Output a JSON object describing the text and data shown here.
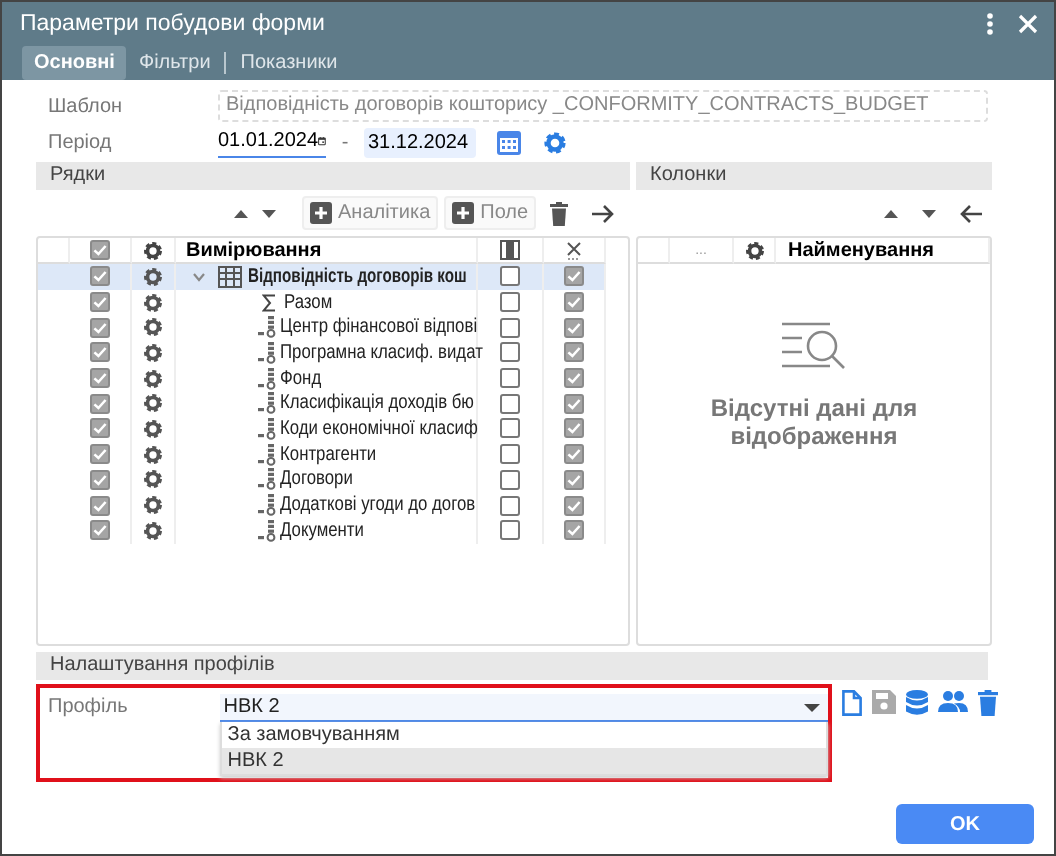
{
  "window": {
    "title": "Параметри побудови форми"
  },
  "tabs": [
    {
      "label": "Основні",
      "selected": true
    },
    {
      "label": "Фільтри",
      "selected": false
    },
    {
      "label": "Показники",
      "selected": false
    }
  ],
  "template": {
    "label": "Шаблон",
    "value": "Відповідність договорів кошторису _CONFORMITY_CONTRACTS_BUDGET"
  },
  "period": {
    "label": "Період",
    "from": "01.01.2024",
    "separator": "-",
    "to": "31.12.2024"
  },
  "rows_panel": {
    "title": "Рядки",
    "add_analytics": "Аналітика",
    "add_field": "Поле",
    "header_checked": true,
    "name_header": "Вимірювання",
    "rows": [
      {
        "label": "Відповідність договорів кош",
        "kind": "table",
        "expanded": true,
        "selected": true,
        "checked": true,
        "column_4_checked": false,
        "column_5_checked": true,
        "children": [
          {
            "label": "Разом",
            "kind": "sum",
            "selected": false,
            "checked": true,
            "column_4_checked": false,
            "column_5_checked": true
          },
          {
            "label": "Центр фінансової відпові",
            "kind": "dimension",
            "selected": false,
            "checked": true,
            "column_4_checked": false,
            "column_5_checked": true
          },
          {
            "label": "Програмна класиф. видат",
            "kind": "dimension",
            "selected": false,
            "checked": true,
            "column_4_checked": false,
            "column_5_checked": true
          },
          {
            "label": "Фонд",
            "kind": "dimension",
            "selected": false,
            "checked": true,
            "column_4_checked": false,
            "column_5_checked": true
          },
          {
            "label": "Класифікація доходів бю",
            "kind": "dimension",
            "selected": false,
            "checked": true,
            "column_4_checked": false,
            "column_5_checked": true
          },
          {
            "label": "Коди економічної класиф",
            "kind": "dimension",
            "selected": false,
            "checked": true,
            "column_4_checked": false,
            "column_5_checked": true
          },
          {
            "label": "Контрагенти",
            "kind": "dimension",
            "selected": false,
            "checked": true,
            "column_4_checked": false,
            "column_5_checked": true
          },
          {
            "label": "Договори",
            "kind": "dimension",
            "selected": false,
            "checked": true,
            "column_4_checked": false,
            "column_5_checked": true
          },
          {
            "label": "Додаткові угоди до догов",
            "kind": "dimension",
            "selected": false,
            "checked": true,
            "column_4_checked": false,
            "column_5_checked": true
          },
          {
            "label": "Документи",
            "kind": "dimension",
            "selected": false,
            "checked": true,
            "column_4_checked": false,
            "column_5_checked": true
          }
        ]
      }
    ]
  },
  "columns_panel": {
    "title": "Колонки",
    "column_1": "...",
    "name_header": "Найменування",
    "empty_text": "Відсутні дані для відображення"
  },
  "profiles": {
    "title": "Налаштування профілів",
    "label": "Профіль",
    "value": "НВК 2",
    "expanded": true,
    "options": [
      {
        "label": "За замовчуванням",
        "selected": false
      },
      {
        "label": "НВК 2",
        "selected": true
      }
    ],
    "actions": [
      {
        "kind": "new",
        "disabled": false
      },
      {
        "kind": "save",
        "disabled": true
      },
      {
        "kind": "database",
        "disabled": false
      },
      {
        "kind": "users",
        "disabled": false
      },
      {
        "kind": "delete",
        "disabled": false
      }
    ]
  },
  "buttons": [
    {
      "label": "OK"
    }
  ]
}
